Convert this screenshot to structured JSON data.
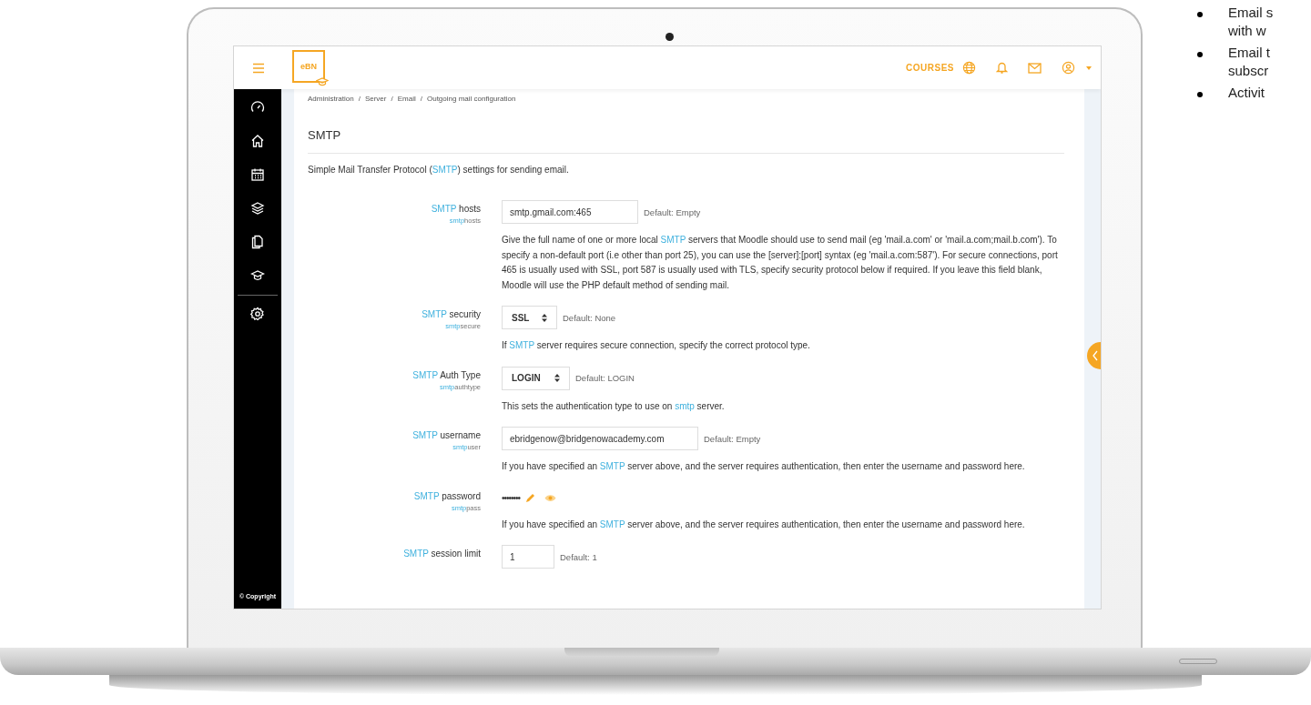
{
  "header": {
    "logo": "eBN",
    "courses": "COURSES"
  },
  "sidebar_footer": "© Copyright",
  "breadcrumb": {
    "items": [
      "Administration",
      "Server",
      "Email",
      "Outgoing mail configuration"
    ],
    "separator": "/"
  },
  "heading": "SMTP",
  "intro": [
    {
      "text": "Simple Mail Transfer Protocol (",
      "link": false
    },
    {
      "text": "SMTP",
      "link": true
    },
    {
      "text": ") settings for sending email.",
      "link": false
    }
  ],
  "settings": [
    {
      "label": [
        {
          "text": "SMTP",
          "link": true
        },
        {
          "text": " hosts",
          "link": false
        }
      ],
      "sub": [
        {
          "text": "smtp",
          "link": true
        },
        {
          "text": "hosts",
          "link": false
        }
      ],
      "kind": "text",
      "value": "smtp.gmail.com:465",
      "default": "Default: Empty",
      "description": [
        {
          "text": "Give the full name of one or more local ",
          "link": false
        },
        {
          "text": "SMTP",
          "link": true
        },
        {
          "text": " servers that Moodle should use to send mail (eg 'mail.a.com' or 'mail.a.com;mail.b.com'). To specify a non-default port (i.e other than port 25), you can use the [server]:[port] syntax (eg 'mail.a.com:587'). For secure connections, port 465 is usually used with SSL, port 587 is usually used with TLS, specify security protocol below if required. If you leave this field blank, Moodle will use the PHP default method of sending mail.",
          "link": false
        }
      ]
    },
    {
      "label": [
        {
          "text": "SMTP",
          "link": true
        },
        {
          "text": " security",
          "link": false
        }
      ],
      "sub": [
        {
          "text": "smtp",
          "link": true
        },
        {
          "text": "secure",
          "link": false
        }
      ],
      "kind": "select",
      "value": "SSL",
      "default": "Default: None",
      "description": [
        {
          "text": "If ",
          "link": false
        },
        {
          "text": "SMTP",
          "link": true
        },
        {
          "text": " server requires secure connection, specify the correct protocol type.",
          "link": false
        }
      ]
    },
    {
      "label": [
        {
          "text": "SMTP",
          "link": true
        },
        {
          "text": " Auth Type",
          "link": false
        }
      ],
      "sub": [
        {
          "text": "smtp",
          "link": true
        },
        {
          "text": "authtype",
          "link": false
        }
      ],
      "kind": "select",
      "value": "LOGIN",
      "default": "Default: LOGIN",
      "description": [
        {
          "text": "This sets the authentication type to use on ",
          "link": false
        },
        {
          "text": "smtp",
          "link": true
        },
        {
          "text": " server.",
          "link": false
        }
      ]
    },
    {
      "label": [
        {
          "text": "SMTP",
          "link": true
        },
        {
          "text": " username",
          "link": false
        }
      ],
      "sub": [
        {
          "text": "smtp",
          "link": true
        },
        {
          "text": "user",
          "link": false
        }
      ],
      "kind": "text",
      "value": "ebridgenow@bridgenowacademy.com",
      "default": "Default: Empty",
      "description": [
        {
          "text": "If you have specified an ",
          "link": false
        },
        {
          "text": "SMTP",
          "link": true
        },
        {
          "text": " server above, and the server requires authentication, then enter the username and password here.",
          "link": false
        }
      ]
    },
    {
      "label": [
        {
          "text": "SMTP",
          "link": true
        },
        {
          "text": " password",
          "link": false
        }
      ],
      "sub": [
        {
          "text": "smtp",
          "link": true
        },
        {
          "text": "pass",
          "link": false
        }
      ],
      "kind": "password",
      "value": "••••••••",
      "description": [
        {
          "text": "If you have specified an ",
          "link": false
        },
        {
          "text": "SMTP",
          "link": true
        },
        {
          "text": " server above, and the server requires authentication, then enter the username and password here.",
          "link": false
        }
      ]
    },
    {
      "label": [
        {
          "text": "SMTP",
          "link": true
        },
        {
          "text": " session limit",
          "link": false
        }
      ],
      "kind": "short",
      "value": "1",
      "default": "Default: 1"
    }
  ],
  "side_list": [
    {
      "lines": [
        "Email s",
        "with w"
      ]
    },
    {
      "lines": [
        "Email t",
        "subscr"
      ]
    },
    {
      "lines": [
        "Activit"
      ]
    }
  ]
}
